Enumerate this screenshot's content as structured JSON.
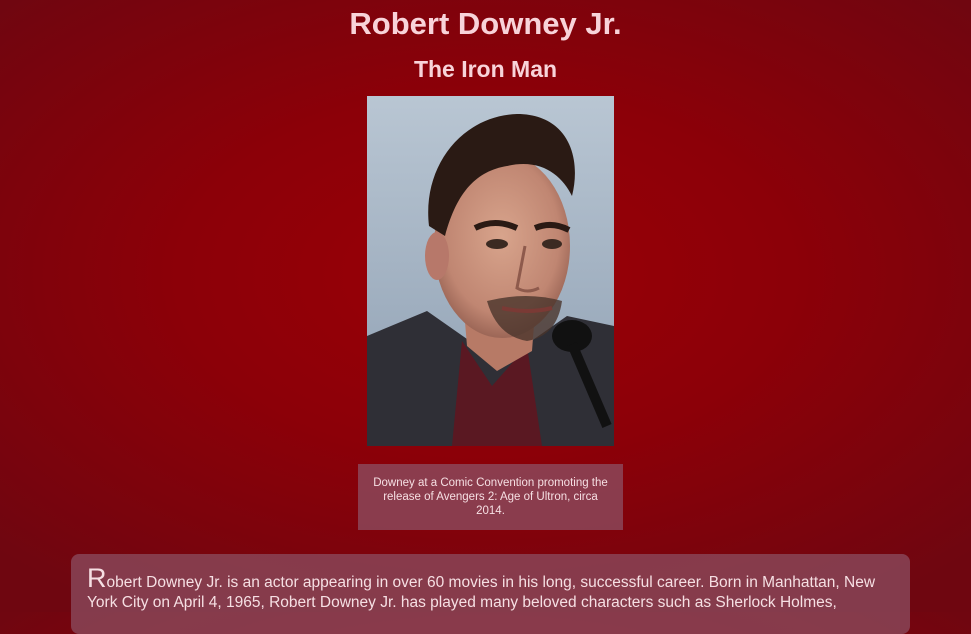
{
  "header": {
    "title": "Robert Downey Jr.",
    "subtitle": "The Iron Man"
  },
  "portrait": {
    "description_icon": "portrait-photo"
  },
  "caption": {
    "text": "Downey at a Comic Convention promoting the release of Avengers 2: Age of Ultron, circa 2014."
  },
  "bio": {
    "first_letter": "R",
    "text": "obert Downey Jr. is an actor appearing in over 60 movies in his long, successful career. Born in Manhattan, New York City on April 4, 1965, Robert Downey Jr. has played many beloved characters such as Sherlock Holmes,"
  },
  "colors": {
    "background": "#8c0008",
    "text": "#f8d3d9",
    "panel": "#8c5064"
  }
}
